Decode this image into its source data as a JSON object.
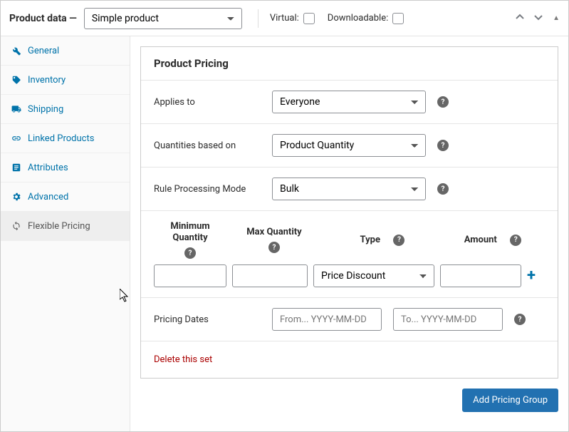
{
  "topbar": {
    "label": "Product data —",
    "product_type": "Simple product",
    "virtual_label": "Virtual:",
    "downloadable_label": "Downloadable:"
  },
  "sidebar": {
    "items": [
      {
        "label": "General",
        "icon": "wrench"
      },
      {
        "label": "Inventory",
        "icon": "tag"
      },
      {
        "label": "Shipping",
        "icon": "truck"
      },
      {
        "label": "Linked Products",
        "icon": "link"
      },
      {
        "label": "Attributes",
        "icon": "note"
      },
      {
        "label": "Advanced",
        "icon": "gear"
      },
      {
        "label": "Flexible Pricing",
        "icon": "refresh"
      }
    ]
  },
  "panel": {
    "title": "Product Pricing",
    "applies_to": {
      "label": "Applies to",
      "value": "Everyone"
    },
    "quantities_based_on": {
      "label": "Quantities based on",
      "value": "Product Quantity"
    },
    "rule_mode": {
      "label": "Rule Processing Mode",
      "value": "Bulk"
    },
    "qty_table": {
      "headers": {
        "min": "Minimum Quantity",
        "max": "Max Quantity",
        "type": "Type",
        "amount": "Amount"
      },
      "row": {
        "min": "",
        "max": "",
        "type": "Price Discount",
        "amount": ""
      }
    },
    "dates": {
      "label": "Pricing Dates",
      "from_placeholder": "From... YYYY-MM-DD",
      "to_placeholder": "To... YYYY-MM-DD"
    },
    "delete_label": "Delete this set",
    "add_group_label": "Add Pricing Group"
  }
}
